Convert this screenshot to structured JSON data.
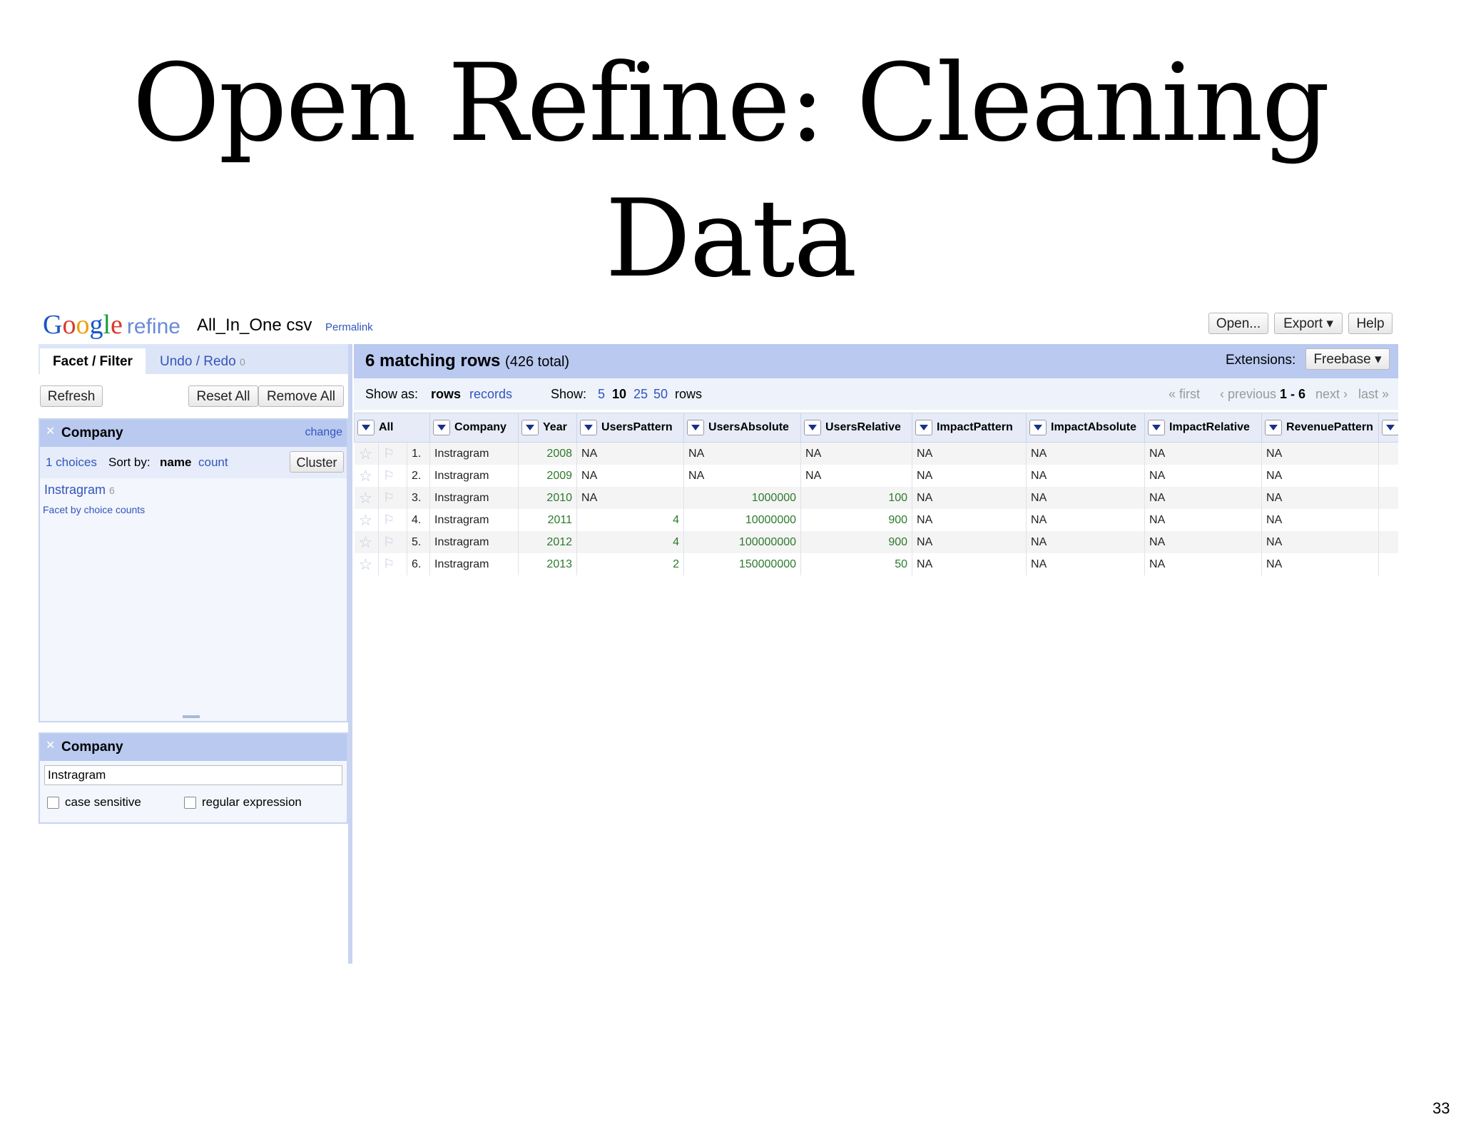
{
  "slide": {
    "title_line1": "Open Refine: Cleaning",
    "title_line2": "Data",
    "page_number": "33"
  },
  "app": {
    "logo_google": [
      "G",
      "o",
      "o",
      "g",
      "l",
      "e"
    ],
    "logo_refine": "refine",
    "project_name": "All_In_One csv",
    "permalink": "Permalink",
    "top_buttons": {
      "open": "Open...",
      "export": "Export ▾",
      "help": "Help"
    },
    "left": {
      "tab_facet": "Facet / Filter",
      "tab_undo": "Undo / Redo",
      "undo_count": "0",
      "refresh": "Refresh",
      "reset_all": "Reset All",
      "remove_all": "Remove All",
      "facet": {
        "title": "Company",
        "change": "change",
        "choices": "1 choices",
        "sort_by": "Sort by:",
        "sort_name": "name",
        "sort_count": "count",
        "cluster": "Cluster",
        "choice_label": "Instragram",
        "choice_count": "6",
        "facet_by_counts": "Facet by choice counts"
      },
      "text_facet": {
        "title": "Company",
        "value": "Instragram",
        "case_sensitive": "case sensitive",
        "regular_expression": "regular expression"
      }
    },
    "right": {
      "matching": "6 matching rows",
      "total": "(426 total)",
      "extensions_label": "Extensions:",
      "extensions_button": "Freebase ▾",
      "show_as": "Show as:",
      "rows": "rows",
      "records": "records",
      "show": "Show:",
      "page_sizes": [
        "5",
        "10",
        "25",
        "50"
      ],
      "rows_suffix": "rows",
      "pager": {
        "first": "« first",
        "previous": "‹ previous",
        "range": "1 - 6",
        "next": "next ›",
        "last": "last »"
      },
      "columns": [
        "All",
        "Company",
        "Year",
        "UsersPattern",
        "UsersAbsolute",
        "UsersRelative",
        "ImpactPattern",
        "ImpactAbsolute",
        "ImpactRelative",
        "RevenuePattern"
      ],
      "rows_data": [
        {
          "index": "1.",
          "company": "Instragram",
          "year": "2008",
          "users_pattern": "NA",
          "users_absolute": "NA",
          "users_relative": "NA",
          "impact_pattern": "NA",
          "impact_absolute": "NA",
          "impact_relative": "NA",
          "revenue_pattern": "NA"
        },
        {
          "index": "2.",
          "company": "Instragram",
          "year": "2009",
          "users_pattern": "NA",
          "users_absolute": "NA",
          "users_relative": "NA",
          "impact_pattern": "NA",
          "impact_absolute": "NA",
          "impact_relative": "NA",
          "revenue_pattern": "NA"
        },
        {
          "index": "3.",
          "company": "Instragram",
          "year": "2010",
          "users_pattern": "NA",
          "users_absolute": "1000000",
          "users_relative": "100",
          "impact_pattern": "NA",
          "impact_absolute": "NA",
          "impact_relative": "NA",
          "revenue_pattern": "NA"
        },
        {
          "index": "4.",
          "company": "Instragram",
          "year": "2011",
          "users_pattern": "4",
          "users_absolute": "10000000",
          "users_relative": "900",
          "impact_pattern": "NA",
          "impact_absolute": "NA",
          "impact_relative": "NA",
          "revenue_pattern": "NA"
        },
        {
          "index": "5.",
          "company": "Instragram",
          "year": "2012",
          "users_pattern": "4",
          "users_absolute": "100000000",
          "users_relative": "900",
          "impact_pattern": "NA",
          "impact_absolute": "NA",
          "impact_relative": "NA",
          "revenue_pattern": "NA"
        },
        {
          "index": "6.",
          "company": "Instragram",
          "year": "2013",
          "users_pattern": "2",
          "users_absolute": "150000000",
          "users_relative": "50",
          "impact_pattern": "NA",
          "impact_absolute": "NA",
          "impact_relative": "NA",
          "revenue_pattern": "NA"
        }
      ]
    }
  }
}
